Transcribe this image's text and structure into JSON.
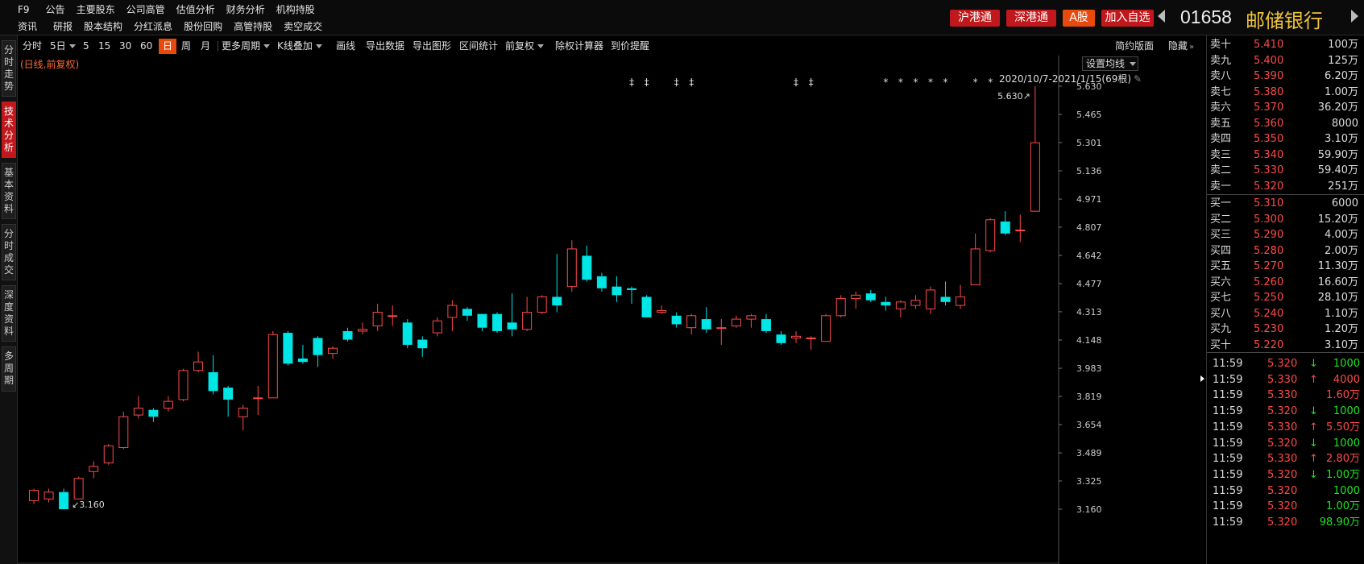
{
  "header": {
    "row1": [
      "F9",
      "公告",
      "主要股东",
      "公司高管",
      "估值分析",
      "财务分析",
      "机构持股"
    ],
    "row2": [
      "资讯",
      "研报",
      "股本结构",
      "分红派息",
      "股份回购",
      "高管持股",
      "卖空成交"
    ],
    "buttons": [
      "沪港通",
      "深港通",
      "A股",
      "加入自选"
    ],
    "code": "01658",
    "name": "邮储银行"
  },
  "left_tabs": [
    "分\n时\n走\n势",
    "技\n术\n分\n析",
    "基\n本\n资\n料",
    "分\n时\n成\n交",
    "深\n度\n资\n料",
    "多\n周\n期"
  ],
  "toolbar": {
    "items": [
      "分时",
      "5日",
      "5",
      "15",
      "30",
      "60",
      "日",
      "周",
      "月",
      "更多周期",
      "K线叠加",
      "画线",
      "导出数据",
      "导出图形",
      "区间统计",
      "前复权",
      "除权计算器",
      "到价提醒"
    ],
    "simple": "简约版面",
    "hide": "隐藏"
  },
  "chart": {
    "mode_label": "(日线,前复权)",
    "ma_button": "设置均线",
    "date_range": "2020/10/7-2021/1/15(69根)",
    "high_label": "5.630",
    "low_label": "3.160"
  },
  "chart_data": {
    "type": "candlestick",
    "y_ticks": [
      "5.630",
      "5.465",
      "5.301",
      "5.136",
      "4.971",
      "4.807",
      "4.642",
      "4.477",
      "4.313",
      "4.148",
      "3.983",
      "3.819",
      "3.654",
      "3.489",
      "3.325",
      "3.160"
    ],
    "ylim": [
      3.16,
      5.63
    ],
    "candles": [
      [
        3.21,
        3.27,
        3.19,
        3.28
      ],
      [
        3.22,
        3.26,
        3.2,
        3.28
      ],
      [
        3.26,
        3.16,
        3.16,
        3.28
      ],
      [
        3.22,
        3.34,
        3.22,
        3.35
      ],
      [
        3.38,
        3.41,
        3.34,
        3.44
      ],
      [
        3.43,
        3.53,
        3.42,
        3.54
      ],
      [
        3.52,
        3.7,
        3.51,
        3.73
      ],
      [
        3.71,
        3.75,
        3.69,
        3.82
      ],
      [
        3.74,
        3.7,
        3.67,
        3.75
      ],
      [
        3.75,
        3.79,
        3.73,
        3.82
      ],
      [
        3.8,
        3.97,
        3.79,
        3.98
      ],
      [
        3.97,
        4.02,
        3.96,
        4.08
      ],
      [
        3.96,
        3.85,
        3.83,
        4.06
      ],
      [
        3.87,
        3.8,
        3.7,
        3.88
      ],
      [
        3.7,
        3.75,
        3.62,
        3.77
      ],
      [
        3.81,
        3.81,
        3.71,
        3.88
      ],
      [
        3.81,
        4.18,
        3.81,
        4.2
      ],
      [
        4.19,
        4.01,
        4.0,
        4.2
      ],
      [
        4.04,
        4.02,
        4.01,
        4.12
      ],
      [
        4.16,
        4.06,
        3.99,
        4.17
      ],
      [
        4.07,
        4.1,
        4.04,
        4.11
      ],
      [
        4.2,
        4.15,
        4.14,
        4.22
      ],
      [
        4.2,
        4.21,
        4.18,
        4.25
      ],
      [
        4.23,
        4.31,
        4.2,
        4.36
      ],
      [
        4.29,
        4.29,
        4.23,
        4.35
      ],
      [
        4.25,
        4.12,
        4.1,
        4.27
      ],
      [
        4.15,
        4.1,
        4.05,
        4.17
      ],
      [
        4.19,
        4.26,
        4.17,
        4.28
      ],
      [
        4.28,
        4.35,
        4.2,
        4.38
      ],
      [
        4.33,
        4.29,
        4.26,
        4.34
      ],
      [
        4.3,
        4.22,
        4.2,
        4.3
      ],
      [
        4.3,
        4.2,
        4.19,
        4.31
      ],
      [
        4.25,
        4.21,
        4.17,
        4.42
      ],
      [
        4.21,
        4.31,
        4.2,
        4.4
      ],
      [
        4.31,
        4.4,
        4.3,
        4.41
      ],
      [
        4.4,
        4.35,
        4.31,
        4.65
      ],
      [
        4.46,
        4.68,
        4.43,
        4.73
      ],
      [
        4.64,
        4.5,
        4.49,
        4.7
      ],
      [
        4.52,
        4.45,
        4.43,
        4.54
      ],
      [
        4.46,
        4.41,
        4.37,
        4.52
      ],
      [
        4.45,
        4.44,
        4.36,
        4.46
      ],
      [
        4.4,
        4.28,
        4.28,
        4.41
      ],
      [
        4.31,
        4.32,
        4.3,
        4.35
      ],
      [
        4.29,
        4.24,
        4.22,
        4.31
      ],
      [
        4.22,
        4.29,
        4.18,
        4.3
      ],
      [
        4.27,
        4.21,
        4.19,
        4.34
      ],
      [
        4.22,
        4.22,
        4.12,
        4.27
      ],
      [
        4.23,
        4.27,
        4.22,
        4.29
      ],
      [
        4.27,
        4.29,
        4.22,
        4.3
      ],
      [
        4.27,
        4.2,
        4.19,
        4.3
      ],
      [
        4.18,
        4.13,
        4.12,
        4.2
      ],
      [
        4.16,
        4.17,
        4.13,
        4.2
      ],
      [
        4.16,
        4.16,
        4.09,
        4.17
      ],
      [
        4.14,
        4.29,
        4.14,
        4.3
      ],
      [
        4.29,
        4.39,
        4.28,
        4.41
      ],
      [
        4.39,
        4.41,
        4.33,
        4.43
      ],
      [
        4.42,
        4.38,
        4.37,
        4.44
      ],
      [
        4.37,
        4.35,
        4.32,
        4.4
      ],
      [
        4.33,
        4.37,
        4.28,
        4.38
      ],
      [
        4.35,
        4.38,
        4.33,
        4.41
      ],
      [
        4.33,
        4.44,
        4.3,
        4.46
      ],
      [
        4.4,
        4.37,
        4.35,
        4.49
      ],
      [
        4.35,
        4.4,
        4.33,
        4.47
      ],
      [
        4.47,
        4.68,
        4.47,
        4.77
      ],
      [
        4.67,
        4.85,
        4.66,
        4.86
      ],
      [
        4.84,
        4.77,
        4.76,
        4.9
      ],
      [
        4.79,
        4.79,
        4.72,
        4.88
      ],
      [
        4.9,
        5.3,
        4.9,
        5.63
      ]
    ],
    "event_markers": [
      {
        "candle": 40,
        "symbol": "‡"
      },
      {
        "candle": 41,
        "symbol": "‡"
      },
      {
        "candle": 43,
        "symbol": "‡"
      },
      {
        "candle": 44,
        "symbol": "‡"
      },
      {
        "candle": 51,
        "symbol": "‡"
      },
      {
        "candle": 52,
        "symbol": "‡"
      },
      {
        "candle": 57,
        "symbol": "*"
      },
      {
        "candle": 58,
        "symbol": "*"
      },
      {
        "candle": 59,
        "symbol": "*"
      },
      {
        "candle": 60,
        "symbol": "*"
      },
      {
        "candle": 61,
        "symbol": "*"
      },
      {
        "candle": 63,
        "symbol": "*"
      },
      {
        "candle": 64,
        "symbol": "*"
      }
    ],
    "high_index": 67,
    "low_index": 2
  },
  "orderbook": {
    "asks": [
      {
        "label": "卖十",
        "price": "5.410",
        "vol": "100万"
      },
      {
        "label": "卖九",
        "price": "5.400",
        "vol": "125万"
      },
      {
        "label": "卖八",
        "price": "5.390",
        "vol": "6.20万"
      },
      {
        "label": "卖七",
        "price": "5.380",
        "vol": "1.00万"
      },
      {
        "label": "卖六",
        "price": "5.370",
        "vol": "36.20万"
      },
      {
        "label": "卖五",
        "price": "5.360",
        "vol": "8000"
      },
      {
        "label": "卖四",
        "price": "5.350",
        "vol": "3.10万"
      },
      {
        "label": "卖三",
        "price": "5.340",
        "vol": "59.90万"
      },
      {
        "label": "卖二",
        "price": "5.330",
        "vol": "59.40万"
      },
      {
        "label": "卖一",
        "price": "5.320",
        "vol": "251万"
      }
    ],
    "bids": [
      {
        "label": "买一",
        "price": "5.310",
        "vol": "6000"
      },
      {
        "label": "买二",
        "price": "5.300",
        "vol": "15.20万"
      },
      {
        "label": "买三",
        "price": "5.290",
        "vol": "4.00万"
      },
      {
        "label": "买四",
        "price": "5.280",
        "vol": "2.00万"
      },
      {
        "label": "买五",
        "price": "5.270",
        "vol": "11.30万"
      },
      {
        "label": "买六",
        "price": "5.260",
        "vol": "16.60万"
      },
      {
        "label": "买七",
        "price": "5.250",
        "vol": "28.10万"
      },
      {
        "label": "买八",
        "price": "5.240",
        "vol": "1.10万"
      },
      {
        "label": "买九",
        "price": "5.230",
        "vol": "1.20万"
      },
      {
        "label": "买十",
        "price": "5.220",
        "vol": "3.10万"
      }
    ]
  },
  "trades": [
    {
      "time": "11:59",
      "price": "5.320",
      "dir": "down",
      "vol": "1000"
    },
    {
      "time": "11:59",
      "price": "5.330",
      "dir": "up",
      "vol": "4000"
    },
    {
      "time": "11:59",
      "price": "5.330",
      "dir": "",
      "vol": "1.60万"
    },
    {
      "time": "11:59",
      "price": "5.320",
      "dir": "down",
      "vol": "1000"
    },
    {
      "time": "11:59",
      "price": "5.330",
      "dir": "up",
      "vol": "5.50万"
    },
    {
      "time": "11:59",
      "price": "5.320",
      "dir": "down",
      "vol": "1000"
    },
    {
      "time": "11:59",
      "price": "5.330",
      "dir": "up",
      "vol": "2.80万"
    },
    {
      "time": "11:59",
      "price": "5.320",
      "dir": "down",
      "vol": "1.00万"
    },
    {
      "time": "11:59",
      "price": "5.320",
      "dir": "",
      "vol": "1000"
    },
    {
      "time": "11:59",
      "price": "5.320",
      "dir": "",
      "vol": "1.00万"
    },
    {
      "time": "11:59",
      "price": "5.320",
      "dir": "",
      "vol": "98.90万"
    }
  ],
  "colors": {
    "up": "#ff4a4a",
    "down": "#00e5e5",
    "accent": "#e84a0d",
    "red_button": "#c0181c",
    "stock_name": "#f0c43a"
  }
}
